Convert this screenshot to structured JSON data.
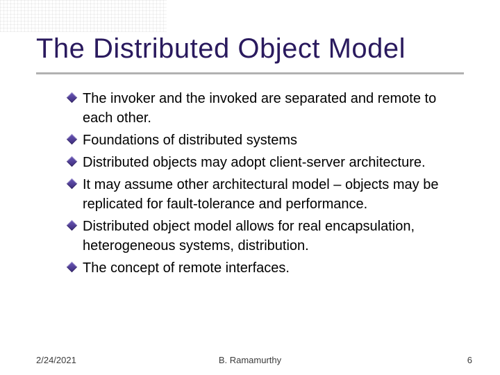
{
  "title": "The Distributed Object Model",
  "bullets": [
    "The invoker and the invoked are separated and remote to each other.",
    "Foundations of distributed systems",
    "Distributed objects may adopt client-server architecture.",
    "It may assume other architectural model – objects may be replicated for fault-tolerance and performance.",
    "Distributed object model allows for real encapsulation, heterogeneous systems, distribution.",
    "The concept of remote interfaces."
  ],
  "footer": {
    "date": "2/24/2021",
    "author": "B. Ramamurthy",
    "page": "6"
  }
}
